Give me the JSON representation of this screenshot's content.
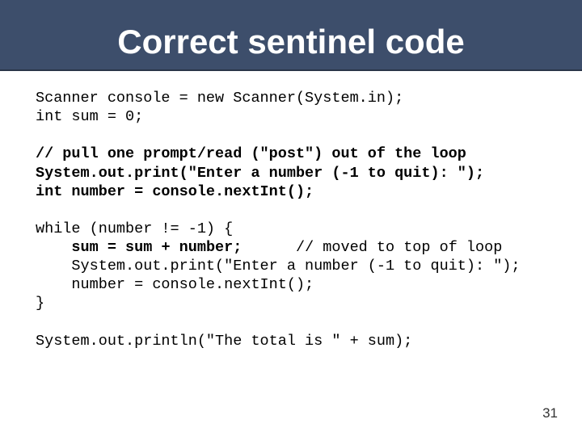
{
  "title": "Correct sentinel code",
  "code": {
    "line1": "Scanner console = new Scanner(System.in);",
    "line2": "int sum = 0;",
    "line3": "",
    "line4_bold": "// pull one prompt/read (\"post\") out of the loop",
    "line5_bold": "System.out.print(\"Enter a number (-1 to quit): \");",
    "line6_bold": "int number = console.nextInt();",
    "line7": "",
    "line8": "while (number != -1) {",
    "line9a": "    ",
    "line9b_bold": "sum = sum + number;",
    "line9c": "      // moved to top of loop",
    "line10": "    System.out.print(\"Enter a number (-1 to quit): \");",
    "line11": "    number = console.nextInt();",
    "line12": "}",
    "line13": "",
    "line14": "System.out.println(\"The total is \" + sum);"
  },
  "page_number": "31"
}
